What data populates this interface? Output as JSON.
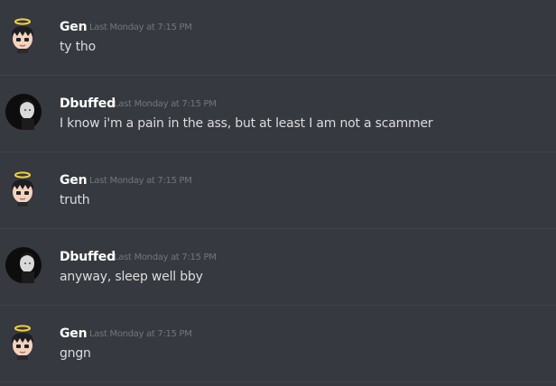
{
  "messages": [
    {
      "author": "Gen",
      "avatar_icon": "anime-halo-avatar-icon",
      "timestamp": "Last Monday at 7:15 PM",
      "text": "ty tho"
    },
    {
      "author": "Dbuffed",
      "avatar_icon": "dark-portrait-avatar-icon",
      "timestamp": "Last Monday at 7:15 PM",
      "text": "I know i'm a pain in the ass, but at least I am not a scammer"
    },
    {
      "author": "Gen",
      "avatar_icon": "anime-halo-avatar-icon",
      "timestamp": "Last Monday at 7:15 PM",
      "text": "truth"
    },
    {
      "author": "Dbuffed",
      "avatar_icon": "dark-portrait-avatar-icon",
      "timestamp": "Last Monday at 7:15 PM",
      "text": "anyway, sleep well bby"
    },
    {
      "author": "Gen",
      "avatar_icon": "anime-halo-avatar-icon",
      "timestamp": "Last Monday at 7:15 PM",
      "text": "gngn"
    }
  ],
  "colors": {
    "background": "#36393f",
    "username": "#ffffff",
    "timestamp": "#72767d",
    "message_text": "#dcddde",
    "divider": "#40434a",
    "halo": "#f3d43b"
  }
}
